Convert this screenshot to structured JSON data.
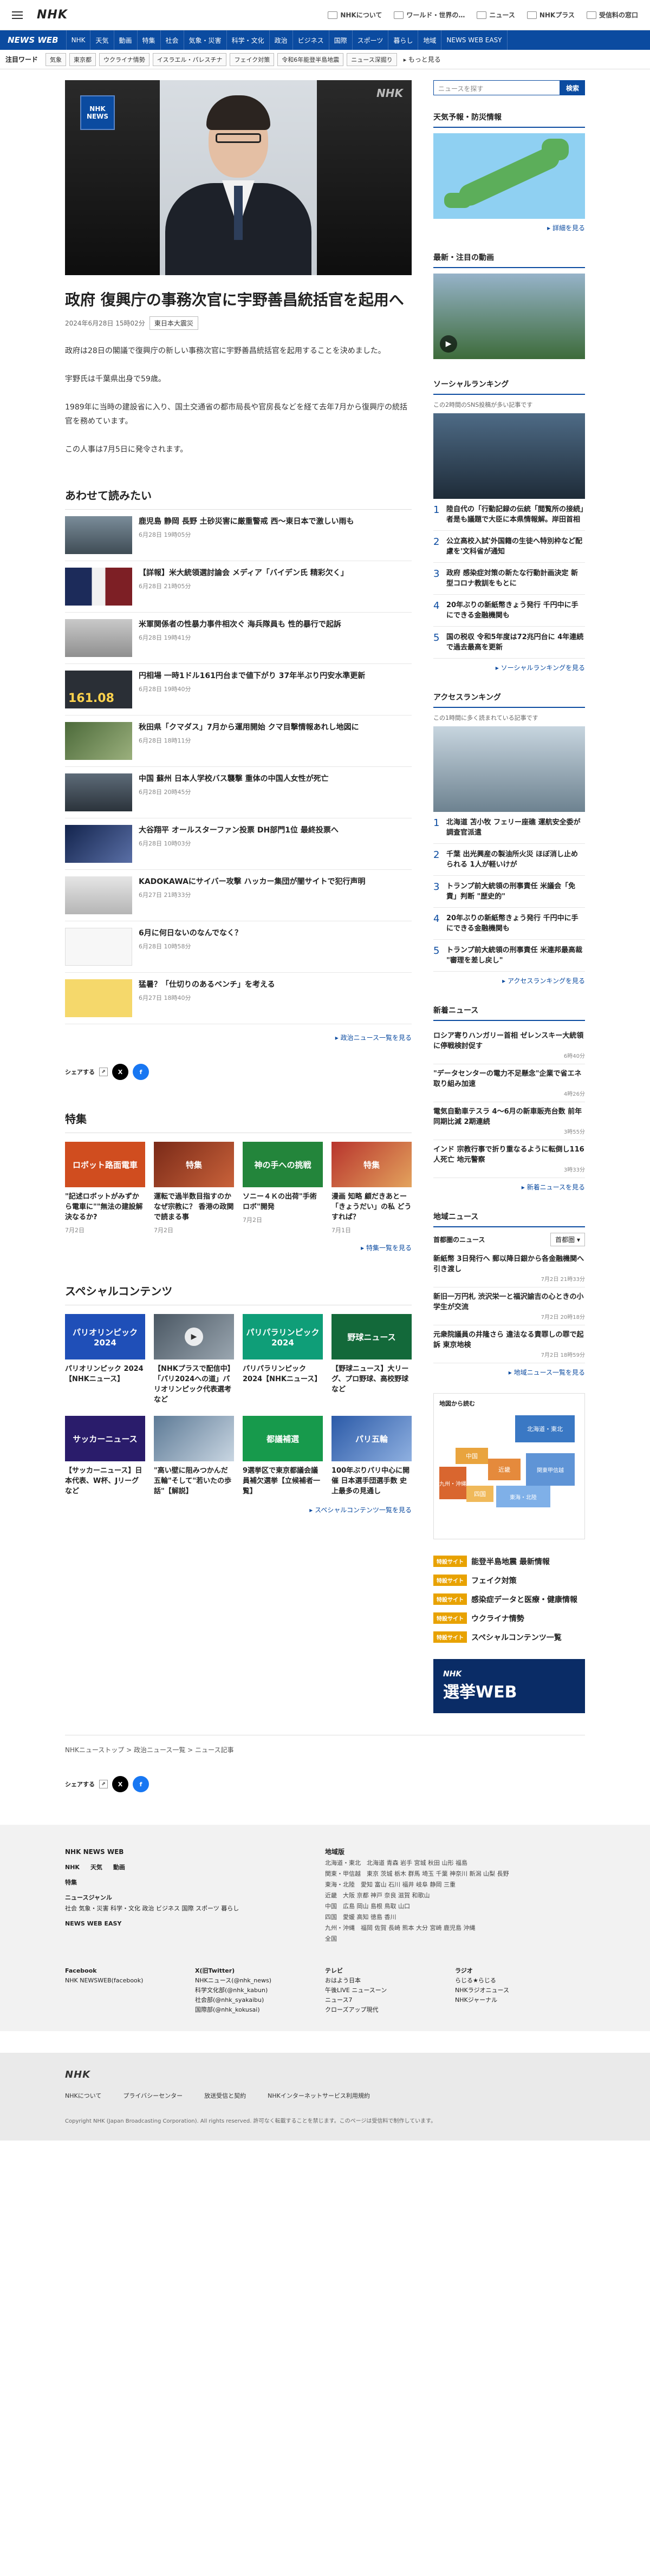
{
  "header": {
    "logo": "NHK",
    "links": [
      {
        "label": "NHKについて"
      },
      {
        "label": "ワールド・世界の…"
      },
      {
        "label": "ニュース"
      },
      {
        "label": "NHKプラス"
      },
      {
        "label": "受信料の窓口"
      }
    ]
  },
  "nav": {
    "brand": "NEWS WEB",
    "items": [
      "NHK",
      "天気",
      "動画",
      "特集",
      "社会",
      "気象・災害",
      "科学・文化",
      "政治",
      "ビジネス",
      "国際",
      "スポーツ",
      "暮らし",
      "地域",
      "NEWS WEB EASY"
    ]
  },
  "attention": {
    "label": "注目ワード",
    "tags": [
      "気象",
      "東京都",
      "ウクライナ情勢",
      "イスラエル・パレスチナ",
      "フェイク対策",
      "令和6年能登半島地震",
      "ニュース深掘り"
    ],
    "more": "もっと見る"
  },
  "article": {
    "hero_logo_top": "NHK",
    "hero_logo_bottom": "NEWS",
    "hero_watermark": "NHK",
    "title": "政府 復興庁の事務次官に宇野善昌統括官を起用へ",
    "date": "2024年6月28日 15時02分",
    "category": "東日本大震災",
    "paragraphs": [
      "政府は28日の閣議で復興庁の新しい事務次官に宇野善昌統括官を起用することを決めました。",
      "宇野氏は千葉県出身で59歳。",
      "1989年に当時の建設省に入り、国土交通省の都市局長や官房長などを経て去年7月から復興庁の統括官を務めています。",
      "この人事は7月5日に発令されます。"
    ]
  },
  "related": {
    "heading": "あわせて読みたい",
    "items": [
      {
        "title": "鹿児島 静岡 長野 土砂災害に厳重警戒 西〜東日本で激しい雨も",
        "date": "6月28日 19時05分"
      },
      {
        "title": "【詳報】米大統領選討論会 メディア「バイデン氏 精彩欠く」",
        "date": "6月28日 21時05分"
      },
      {
        "title": "米軍関係者の性暴力事件相次ぐ 海兵隊員も 性的暴行で起訴",
        "date": "6月28日 19時41分"
      },
      {
        "title": "円相場 一時1ドル161円台まで値下がり 37年半ぶり円安水準更新",
        "date": "6月28日 19時40分"
      },
      {
        "title": "秋田県「クマダス」7月から運用開始 クマ目撃情報あれし地図に",
        "date": "6月28日 18時11分"
      },
      {
        "title": "中国 蘇州 日本人学校バス襲撃 重体の中国人女性が死亡",
        "date": "6月28日 20時45分"
      },
      {
        "title": "大谷翔平 オールスターファン投票 DH部門1位 最終投票へ",
        "date": "6月28日 10時03分"
      },
      {
        "title": "KADOKAWAにサイバー攻撃 ハッカー集団が闇サイトで犯行声明",
        "date": "6月27日 21時33分"
      },
      {
        "title": "6月に何日ないのなんでなく？",
        "date": "6月28日 10時58分"
      },
      {
        "title": "猛暑？「仕切りのあるベンチ」を考える",
        "date": "6月27日 18時40分"
      }
    ],
    "more": "政治ニュース一覧を見る"
  },
  "share": {
    "label": "シェアする"
  },
  "features": {
    "heading": "特集",
    "items": [
      {
        "title": "\"記述ロボットがみずから電車に\"\"無法の建設解決なるか?",
        "date": "7月2日",
        "badge": "ロボット路面電車"
      },
      {
        "title": "運転で過半数目指すのかなぜ宗教に？ 香港の政関で読まる事",
        "date": "7月2日",
        "badge": "特集"
      },
      {
        "title": "ソニー４Ｋの出荷\"手術ロボ\"開発",
        "date": "7月2日",
        "badge": "神の手への挑戦"
      },
      {
        "title": "漫画 知略 顧だきあとー「きょうだい」の私 どうすれば？",
        "date": "7月1日",
        "badge": "特集"
      }
    ],
    "more": "特集一覧を見る"
  },
  "special": {
    "heading": "スペシャルコンテンツ",
    "items": [
      {
        "title": "パリオリンピック 2024【NHKニュース】",
        "badge": "パリオリンピック 2024"
      },
      {
        "title": "【NHKプラスで配信中】「パリ2024への道」パリオリンピック代表選考など",
        "badge": ""
      },
      {
        "title": "パリパラリンピック 2024【NHKニュース】",
        "badge": "パリパラリンピック 2024"
      },
      {
        "title": "【野球ニュース】大リーグ、プロ野球、高校野球など",
        "badge": "野球ニュース"
      },
      {
        "title": "【サッカーニュース】日本代表、W杯、Jリーグなど",
        "badge": "サッカーニュース"
      },
      {
        "title": "\"高い壁に阻みつかんだ五輪\"そして\"若いたの歩話\"【解説】",
        "badge": ""
      },
      {
        "title": "9選挙区で東京都議会議員補欠選挙【立候補者一覧】",
        "badge": "都議補選"
      },
      {
        "title": "100年ぶりパリ中心に開催 日本選手団選手数 史上最多の見通し",
        "badge": "パリ五輪"
      }
    ],
    "more": "スペシャルコンテンツ一覧を見る"
  },
  "sidebar": {
    "search_placeholder": "ニュースを探す",
    "search_button": "検索",
    "weather_title": "天気予報・防災情報",
    "weather_link": "詳細を見る",
    "video_title": "最新・注目の動画",
    "social": {
      "title": "ソーシャルランキング",
      "subtitle": "この2時間のSNS投稿が多い記事です",
      "items": [
        "陸自代の「行動記録の伝統「閲覧所の接続」者是も議題で大臣に本県情報解。岸田首相",
        "公立高校入試'外国籍の生徒へ特別枠など配慮を'文科省が通知",
        "政府 感染症対策の新たな行動計画決定 新型コロナ教訓をもとに",
        "20年ぶりの新紙幣きょう発行 千円中に手にできる金融機関も",
        "国の税収 令和5年度は72兆円台に 4年連続で過去最高を更新"
      ],
      "more": "ソーシャルランキングを見る"
    },
    "access": {
      "title": "アクセスランキング",
      "subtitle": "この1時間に多く読まれている記事です",
      "items": [
        "北海道 苫小牧 フェリー座礁 運航安全委が調査官派遣",
        "千葉 出光興産の製油所火災 ほぼ消し止められる 1人が軽いけが",
        "トランプ前大統領の刑事責任 米議会「免責」判断 \"歴史的\"",
        "20年ぶりの新紙幣きょう発行 千円中に手にできる金融機関も",
        "トランプ前大統領の刑事責任 米連邦最高裁 \"審理を差し戻し\""
      ],
      "more": "アクセスランキングを見る"
    },
    "new_news": {
      "title": "新着ニュース",
      "items": [
        {
          "title": "ロシア寄りハンガリー首相 ゼレンスキー大統領に停戦検討促す",
          "date": "6時40分"
        },
        {
          "title": "\"データセンターの電力不足懸念\"企業で省エネ取り組み加速",
          "date": "4時26分"
        },
        {
          "title": "電気自動車テスラ 4〜6月の新車販売台数 前年同期比減 2期連続",
          "date": "3時55分"
        },
        {
          "title": "インド 宗教行事で折り重なるように転倒し116人死亡 地元警察",
          "date": "3時33分"
        }
      ],
      "more": "新着ニュースを見る"
    },
    "local": {
      "title": "地域ニュース",
      "region": "首都圏のニュース",
      "select": "首都圏",
      "items": [
        {
          "title": "新紙幣 3日発行へ 郵以降日銀から各金融機関へ引き渡し",
          "date": "7月2日 21時33分"
        },
        {
          "title": "新旧一万円札 渋沢栄一と福沢諭吉の心ときの小学生が交流",
          "date": "7月2日 20時18分"
        },
        {
          "title": "元衆院議員の井隆さら 違法なる責罪しの罪で起訴 東京地検",
          "date": "7月2日 18時59分"
        }
      ],
      "more": "地域ニュース一覧を見る"
    },
    "map_title": "地図から読む",
    "regions": [
      "北海道・東北",
      "関東甲信越",
      "東海・北陸",
      "近畿",
      "中国",
      "四国",
      "九州・沖縄"
    ],
    "pills": [
      {
        "badge": "特設サイト",
        "label": "能登半島地震 最新情報"
      },
      {
        "badge": "特設サイト",
        "label": "フェイク対策"
      },
      {
        "badge": "特設サイト",
        "label": "感染症データと医療・健康情報"
      },
      {
        "badge": "特設サイト",
        "label": "ウクライナ情勢"
      },
      {
        "badge": "特設サイト",
        "label": "スペシャルコンテンツ一覧"
      }
    ],
    "banner_top": "NHK",
    "banner_bottom": "選挙WEB"
  },
  "breadcrumb": "NHKニューストップ  >  政治ニュース一覧  >  ニュース記事",
  "footer": {
    "brand": "NHK NEWS WEB",
    "links1": [
      "NHK",
      "天気",
      "動画"
    ],
    "feature": "特集",
    "genre_title": "ニュースジャンル",
    "genres": "社会 気象・災害 科学・文化 政治 ビジネス 国際 スポーツ 暮らし",
    "easy": "NEWS WEB EASY",
    "area_title": "地域版",
    "areas": [
      "北海道・東北　北海道 青森 岩手 宮城 秋田 山形 福島",
      "関東・甲信越　東京 茨城 栃木 群馬 埼玉 千葉 神奈川 新潟 山梨 長野",
      "東海・北陸　愛知 富山 石川 福井 岐阜 静岡 三重",
      "近畿　大阪 京都 神戸 奈良 滋賀 和歌山",
      "中国　広島 岡山 島根 鳥取 山口",
      "四国　愛媛 高知 徳島 香川",
      "九州・沖縄　福岡 佐賀 長崎 熊本 大分 宮崎 鹿児島 沖縄",
      "全国"
    ],
    "sub": [
      [
        "Facebook",
        "NHK NEWSWEB(facebook)"
      ],
      [
        "X(旧Twitter)",
        "NHKニュース(@nhk_news)",
        "科学文化部(@nhk_kabun)",
        "社会部(@nhk_syakaibu)",
        "国際部(@nhk_kokusai)"
      ],
      [
        "テレビ",
        "おはよう日本",
        "午後LIVE ニュースーン",
        "ニュース7",
        "クローズアップ現代"
      ],
      [
        "ラジオ",
        "らじる★らじる",
        "NHKラジオニュース",
        "NHKジャーナル"
      ]
    ],
    "bottom_links": [
      "NHKについて",
      "プライバシーセンター",
      "放送受信と契約",
      "NHKインターネットサービス利用規約"
    ],
    "copyright": "Copyright NHK (Japan Broadcasting Corporation). All rights reserved. 許可なく転載することを禁じます。このページは受信料で制作しています。"
  }
}
